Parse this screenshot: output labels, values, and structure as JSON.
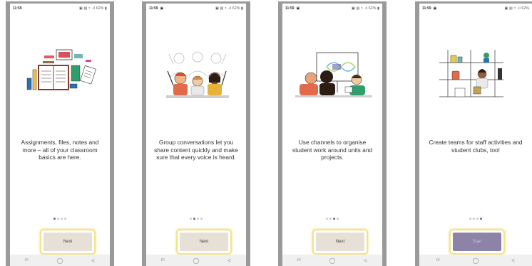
{
  "screens": [
    {
      "status": {
        "time": "11:59",
        "notif": "",
        "icons": "▣ ▤ ≈ ·ıl 62% ▮"
      },
      "text": "Assignments, files, notes and more – all of your classroom basics are here.",
      "dots_active": 0,
      "button": "Next"
    },
    {
      "status": {
        "time": "11:59",
        "notif": "▣",
        "icons": "▣ ▤ ≈ ·ıl 62% ▮"
      },
      "text": "Group conversations let you share content quickly and make sure that every voice is heard.",
      "dots_active": 1,
      "button": "Next"
    },
    {
      "status": {
        "time": "11:59",
        "notif": "▣",
        "icons": "▣ ▤ ≈ ·ıl 62% ▮"
      },
      "text": "Use channels to organise student work around units and projects.",
      "dots_active": 2,
      "button": "Next"
    },
    {
      "status": {
        "time": "11:59",
        "notif": "▣",
        "icons": "▣ ▤ ≈ ·ıl 62%"
      },
      "text": "Create teams for staff activities and student clubs, too!",
      "dots_active": 3,
      "button": "Start"
    }
  ],
  "nav": {
    "recent": "III",
    "home": "◯",
    "back": "<"
  },
  "icons": [
    "classroom-supplies-illustration",
    "students-raising-hands-illustration",
    "students-at-whiteboard-illustration",
    "teams-shelves-illustration"
  ],
  "colors": {
    "accent": "#6264a7",
    "button": "#e6e0d7",
    "highlight": "#f5e28a"
  }
}
